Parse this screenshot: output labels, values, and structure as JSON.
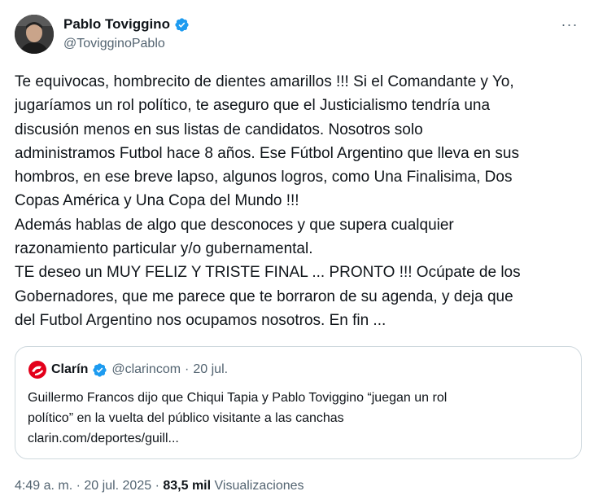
{
  "author": {
    "display_name": "Pablo Toviggino",
    "handle": "@TovigginoPablo",
    "verified": true
  },
  "more_label": "···",
  "tweet_text": "Te equivocas, hombrecito de dientes amarillos !!! Si el Comandante y Yo,\njugaríamos un rol político, te aseguro que el Justicialismo tendría una\ndiscusión menos en sus listas de candidatos. Nosotros solo\nadministramos Futbol hace 8 años. Ese Fútbol Argentino que lleva en sus\nhombros, en ese breve lapso, algunos logros, como Una Finalisima, Dos\nCopas América y Una Copa del Mundo !!!\nAdemás hablas de algo que desconoces y que supera cualquier\nrazonamiento particular y/o gubernamental.\nTE deseo un MUY FELIZ Y TRISTE FINAL ... PRONTO !!! Ocúpate de los\nGobernadores, que me parece que te borraron de su agenda, y deja que\ndel Futbol Argentino nos ocupamos nosotros. En fin ...",
  "quoted": {
    "display_name": "Clarín",
    "handle": "@clarincom",
    "separator": "·",
    "date": "20 jul.",
    "text": "Guillermo Francos dijo que Chiqui Tapia y Pablo Toviggino “juegan un rol\npolítico” en la vuelta del público visitante a las canchas\nclarin.com/deportes/guill...",
    "logo_color": "#e3001b"
  },
  "footer": {
    "time": "4:49 a. m.",
    "separator": "·",
    "date": "20 jul. 2025",
    "views_count": "83,5 mil",
    "views_label": "Visualizaciones"
  },
  "colors": {
    "verified": "#1d9bf0",
    "text": "#0f1419",
    "secondary": "#536471",
    "border": "#cfd9de"
  }
}
